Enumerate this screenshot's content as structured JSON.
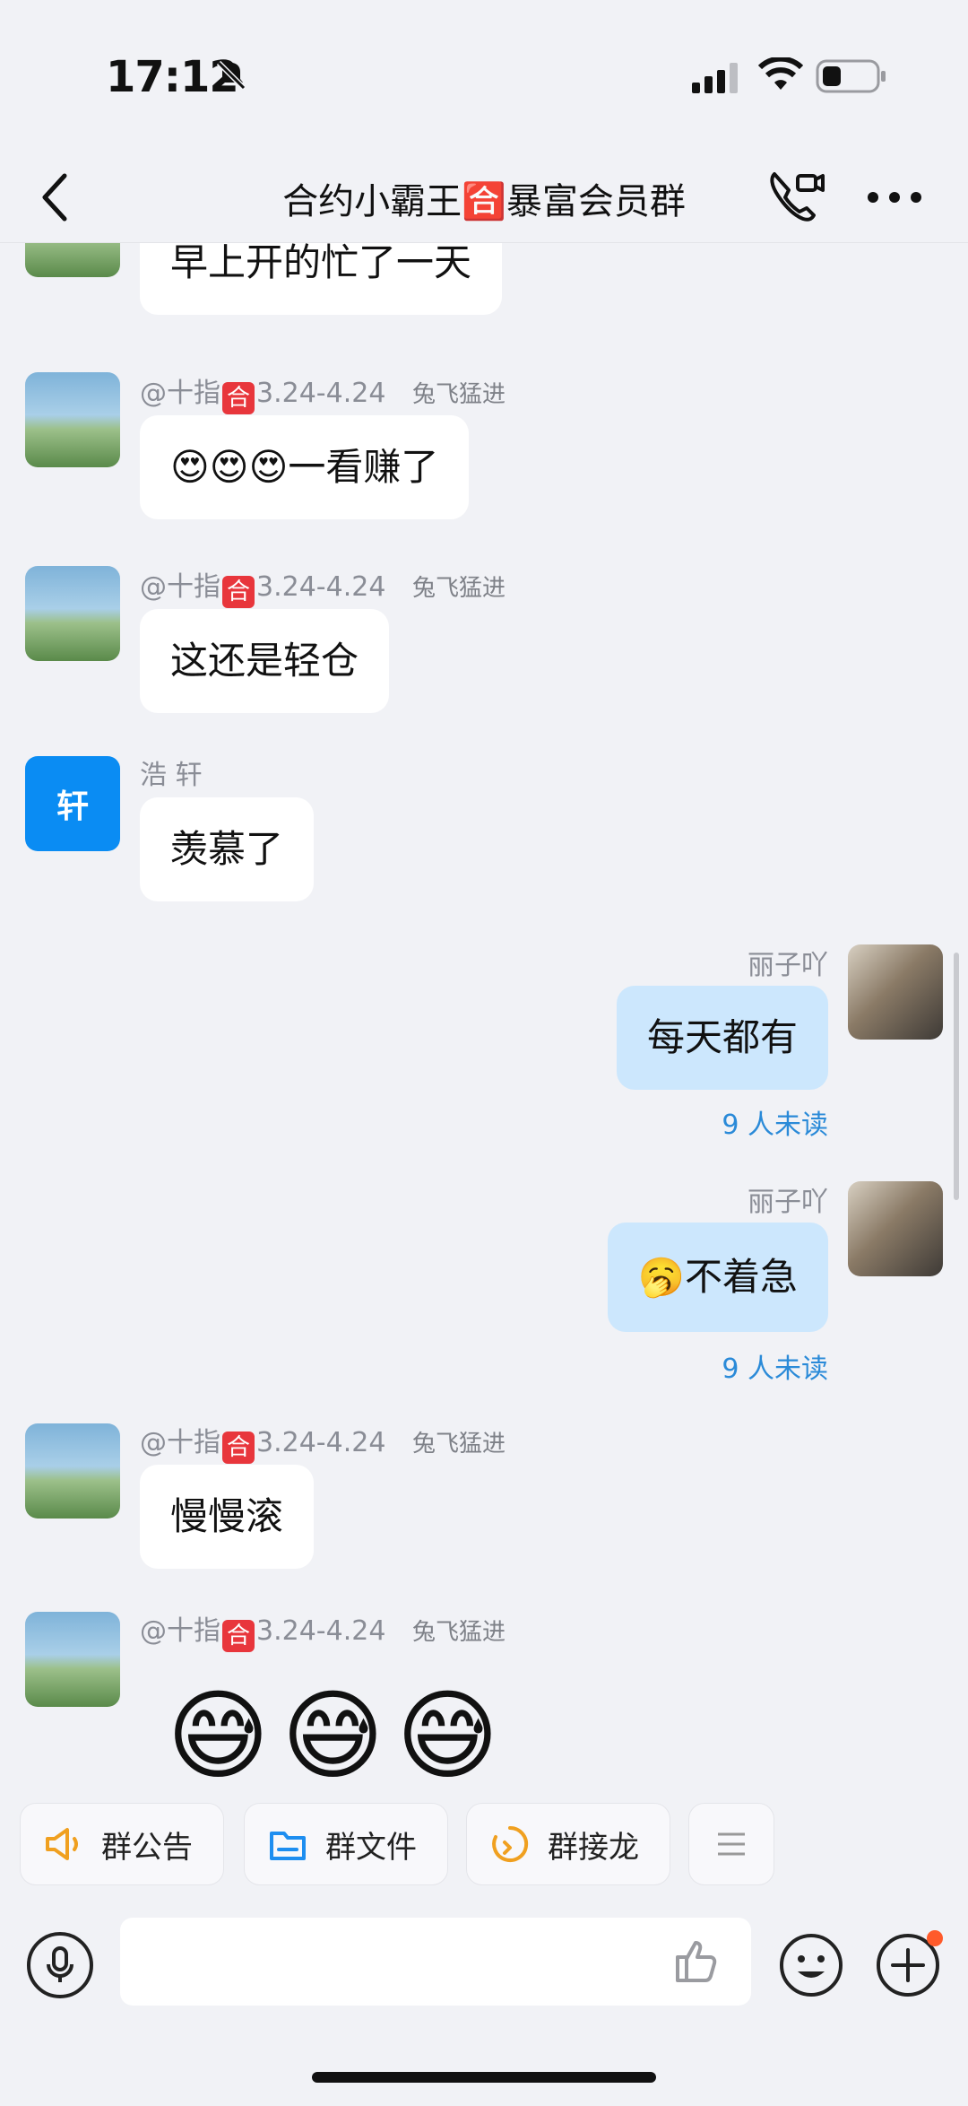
{
  "status": {
    "time": "17:12"
  },
  "header": {
    "title": "合约小霸王🈴暴富会员群"
  },
  "messages": [
    {
      "text": "早上开的忙了一天"
    },
    {
      "sender_prefix": "@十指",
      "sender_suffix": "3.24-4.24",
      "tag": "兔飞猛进",
      "text": "😍😍😍一看赚了"
    },
    {
      "sender_prefix": "@十指",
      "sender_suffix": "3.24-4.24",
      "tag": "兔飞猛进",
      "text": "这还是轻仓"
    },
    {
      "sender": "浩 轩",
      "avatar_text": "轩",
      "text": "羡慕了"
    },
    {
      "sender": "丽子吖",
      "text": "每天都有",
      "unread": "9 人未读"
    },
    {
      "sender": "丽子吖",
      "text": "🥱不着急",
      "unread": "9 人未读"
    },
    {
      "sender_prefix": "@十指",
      "sender_suffix": "3.24-4.24",
      "tag": "兔飞猛进",
      "text": "慢慢滚"
    },
    {
      "sender_prefix": "@十指",
      "sender_suffix": "3.24-4.24",
      "tag": "兔飞猛进",
      "emojis": [
        "😅",
        "😅",
        "😅"
      ]
    }
  ],
  "he_badge": "合",
  "quick_actions": [
    {
      "label": "群公告",
      "icon": "megaphone-icon"
    },
    {
      "label": "群文件",
      "icon": "folder-icon"
    },
    {
      "label": "群接龙",
      "icon": "relay-icon"
    }
  ],
  "colors": {
    "accent": "#0a8cf3",
    "bubble_mine": "#cce7fd",
    "unread": "#2a8ad8",
    "badge": "#e8363c"
  }
}
